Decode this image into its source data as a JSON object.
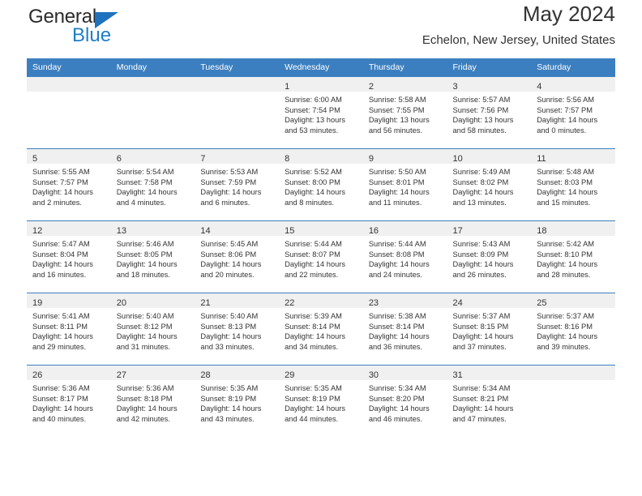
{
  "brand": {
    "name_part1": "General",
    "name_part2": "Blue",
    "triangle_color": "#1f72bd",
    "blue_color": "#1f7ec4"
  },
  "header": {
    "title": "May 2024",
    "subtitle": "Echelon, New Jersey, United States",
    "header_bg": "#3c7fc0",
    "daynum_band_bg": "#f0f0f0"
  },
  "weekday_headers": [
    "Sunday",
    "Monday",
    "Tuesday",
    "Wednesday",
    "Thursday",
    "Friday",
    "Saturday"
  ],
  "weeks": [
    [
      {
        "empty": true
      },
      {
        "empty": true
      },
      {
        "empty": true
      },
      {
        "empty": false,
        "day": "1",
        "sunrise": "Sunrise: 6:00 AM",
        "sunset": "Sunset: 7:54 PM",
        "daylight_line1": "Daylight: 13 hours",
        "daylight_line2": "and 53 minutes."
      },
      {
        "empty": false,
        "day": "2",
        "sunrise": "Sunrise: 5:58 AM",
        "sunset": "Sunset: 7:55 PM",
        "daylight_line1": "Daylight: 13 hours",
        "daylight_line2": "and 56 minutes."
      },
      {
        "empty": false,
        "day": "3",
        "sunrise": "Sunrise: 5:57 AM",
        "sunset": "Sunset: 7:56 PM",
        "daylight_line1": "Daylight: 13 hours",
        "daylight_line2": "and 58 minutes."
      },
      {
        "empty": false,
        "day": "4",
        "sunrise": "Sunrise: 5:56 AM",
        "sunset": "Sunset: 7:57 PM",
        "daylight_line1": "Daylight: 14 hours",
        "daylight_line2": "and 0 minutes."
      }
    ],
    [
      {
        "empty": false,
        "day": "5",
        "sunrise": "Sunrise: 5:55 AM",
        "sunset": "Sunset: 7:57 PM",
        "daylight_line1": "Daylight: 14 hours",
        "daylight_line2": "and 2 minutes."
      },
      {
        "empty": false,
        "day": "6",
        "sunrise": "Sunrise: 5:54 AM",
        "sunset": "Sunset: 7:58 PM",
        "daylight_line1": "Daylight: 14 hours",
        "daylight_line2": "and 4 minutes."
      },
      {
        "empty": false,
        "day": "7",
        "sunrise": "Sunrise: 5:53 AM",
        "sunset": "Sunset: 7:59 PM",
        "daylight_line1": "Daylight: 14 hours",
        "daylight_line2": "and 6 minutes."
      },
      {
        "empty": false,
        "day": "8",
        "sunrise": "Sunrise: 5:52 AM",
        "sunset": "Sunset: 8:00 PM",
        "daylight_line1": "Daylight: 14 hours",
        "daylight_line2": "and 8 minutes."
      },
      {
        "empty": false,
        "day": "9",
        "sunrise": "Sunrise: 5:50 AM",
        "sunset": "Sunset: 8:01 PM",
        "daylight_line1": "Daylight: 14 hours",
        "daylight_line2": "and 11 minutes."
      },
      {
        "empty": false,
        "day": "10",
        "sunrise": "Sunrise: 5:49 AM",
        "sunset": "Sunset: 8:02 PM",
        "daylight_line1": "Daylight: 14 hours",
        "daylight_line2": "and 13 minutes."
      },
      {
        "empty": false,
        "day": "11",
        "sunrise": "Sunrise: 5:48 AM",
        "sunset": "Sunset: 8:03 PM",
        "daylight_line1": "Daylight: 14 hours",
        "daylight_line2": "and 15 minutes."
      }
    ],
    [
      {
        "empty": false,
        "day": "12",
        "sunrise": "Sunrise: 5:47 AM",
        "sunset": "Sunset: 8:04 PM",
        "daylight_line1": "Daylight: 14 hours",
        "daylight_line2": "and 16 minutes."
      },
      {
        "empty": false,
        "day": "13",
        "sunrise": "Sunrise: 5:46 AM",
        "sunset": "Sunset: 8:05 PM",
        "daylight_line1": "Daylight: 14 hours",
        "daylight_line2": "and 18 minutes."
      },
      {
        "empty": false,
        "day": "14",
        "sunrise": "Sunrise: 5:45 AM",
        "sunset": "Sunset: 8:06 PM",
        "daylight_line1": "Daylight: 14 hours",
        "daylight_line2": "and 20 minutes."
      },
      {
        "empty": false,
        "day": "15",
        "sunrise": "Sunrise: 5:44 AM",
        "sunset": "Sunset: 8:07 PM",
        "daylight_line1": "Daylight: 14 hours",
        "daylight_line2": "and 22 minutes."
      },
      {
        "empty": false,
        "day": "16",
        "sunrise": "Sunrise: 5:44 AM",
        "sunset": "Sunset: 8:08 PM",
        "daylight_line1": "Daylight: 14 hours",
        "daylight_line2": "and 24 minutes."
      },
      {
        "empty": false,
        "day": "17",
        "sunrise": "Sunrise: 5:43 AM",
        "sunset": "Sunset: 8:09 PM",
        "daylight_line1": "Daylight: 14 hours",
        "daylight_line2": "and 26 minutes."
      },
      {
        "empty": false,
        "day": "18",
        "sunrise": "Sunrise: 5:42 AM",
        "sunset": "Sunset: 8:10 PM",
        "daylight_line1": "Daylight: 14 hours",
        "daylight_line2": "and 28 minutes."
      }
    ],
    [
      {
        "empty": false,
        "day": "19",
        "sunrise": "Sunrise: 5:41 AM",
        "sunset": "Sunset: 8:11 PM",
        "daylight_line1": "Daylight: 14 hours",
        "daylight_line2": "and 29 minutes."
      },
      {
        "empty": false,
        "day": "20",
        "sunrise": "Sunrise: 5:40 AM",
        "sunset": "Sunset: 8:12 PM",
        "daylight_line1": "Daylight: 14 hours",
        "daylight_line2": "and 31 minutes."
      },
      {
        "empty": false,
        "day": "21",
        "sunrise": "Sunrise: 5:40 AM",
        "sunset": "Sunset: 8:13 PM",
        "daylight_line1": "Daylight: 14 hours",
        "daylight_line2": "and 33 minutes."
      },
      {
        "empty": false,
        "day": "22",
        "sunrise": "Sunrise: 5:39 AM",
        "sunset": "Sunset: 8:14 PM",
        "daylight_line1": "Daylight: 14 hours",
        "daylight_line2": "and 34 minutes."
      },
      {
        "empty": false,
        "day": "23",
        "sunrise": "Sunrise: 5:38 AM",
        "sunset": "Sunset: 8:14 PM",
        "daylight_line1": "Daylight: 14 hours",
        "daylight_line2": "and 36 minutes."
      },
      {
        "empty": false,
        "day": "24",
        "sunrise": "Sunrise: 5:37 AM",
        "sunset": "Sunset: 8:15 PM",
        "daylight_line1": "Daylight: 14 hours",
        "daylight_line2": "and 37 minutes."
      },
      {
        "empty": false,
        "day": "25",
        "sunrise": "Sunrise: 5:37 AM",
        "sunset": "Sunset: 8:16 PM",
        "daylight_line1": "Daylight: 14 hours",
        "daylight_line2": "and 39 minutes."
      }
    ],
    [
      {
        "empty": false,
        "day": "26",
        "sunrise": "Sunrise: 5:36 AM",
        "sunset": "Sunset: 8:17 PM",
        "daylight_line1": "Daylight: 14 hours",
        "daylight_line2": "and 40 minutes."
      },
      {
        "empty": false,
        "day": "27",
        "sunrise": "Sunrise: 5:36 AM",
        "sunset": "Sunset: 8:18 PM",
        "daylight_line1": "Daylight: 14 hours",
        "daylight_line2": "and 42 minutes."
      },
      {
        "empty": false,
        "day": "28",
        "sunrise": "Sunrise: 5:35 AM",
        "sunset": "Sunset: 8:19 PM",
        "daylight_line1": "Daylight: 14 hours",
        "daylight_line2": "and 43 minutes."
      },
      {
        "empty": false,
        "day": "29",
        "sunrise": "Sunrise: 5:35 AM",
        "sunset": "Sunset: 8:19 PM",
        "daylight_line1": "Daylight: 14 hours",
        "daylight_line2": "and 44 minutes."
      },
      {
        "empty": false,
        "day": "30",
        "sunrise": "Sunrise: 5:34 AM",
        "sunset": "Sunset: 8:20 PM",
        "daylight_line1": "Daylight: 14 hours",
        "daylight_line2": "and 46 minutes."
      },
      {
        "empty": false,
        "day": "31",
        "sunrise": "Sunrise: 5:34 AM",
        "sunset": "Sunset: 8:21 PM",
        "daylight_line1": "Daylight: 14 hours",
        "daylight_line2": "and 47 minutes."
      },
      {
        "empty": true
      }
    ]
  ]
}
